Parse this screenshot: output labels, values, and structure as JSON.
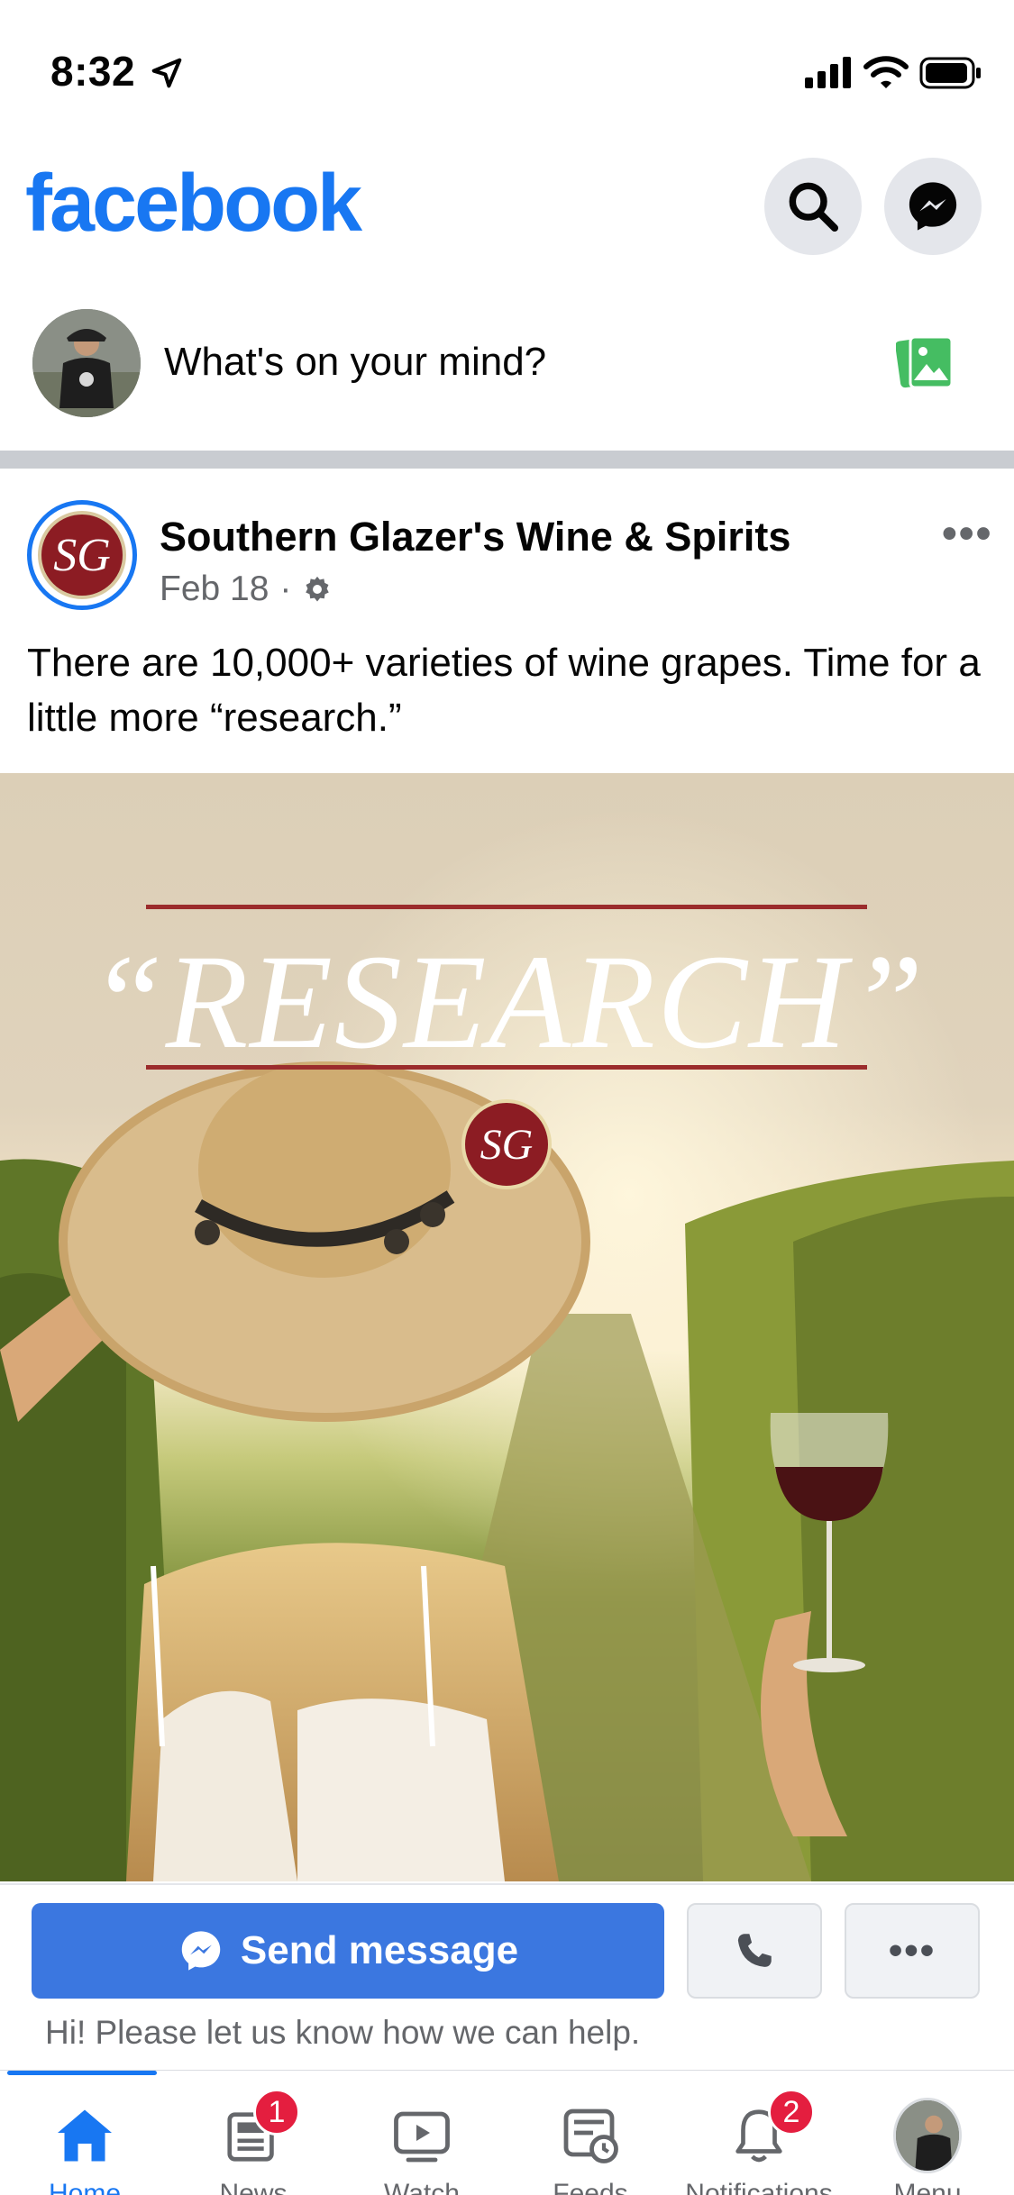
{
  "status_bar": {
    "time": "8:32"
  },
  "header": {
    "logo": "facebook",
    "brand_color": "#1877f2",
    "icons": [
      "search-icon",
      "messenger-icon"
    ]
  },
  "composer": {
    "prompt": "What's on your mind?",
    "photo_icon": "photo-icon"
  },
  "post": {
    "page_name": "Southern Glazer's Wine & Spirits",
    "date": "Feb 18",
    "separator": "·",
    "privacy_icon": "gear-icon",
    "text": "There are 10,000+ varieties of wine grapes. Time for a little more “research.”",
    "image": {
      "headline": "“RESEARCH”",
      "logo_text": "SG"
    },
    "avatar_logo_text": "SG"
  },
  "cta": {
    "send_label": "Send message",
    "accent_color": "#3b77e0",
    "call_icon": "phone-icon",
    "more_label": "•••",
    "helper_text": "Hi! Please let us know how we can help."
  },
  "tab_bar": {
    "tabs": [
      {
        "label": "Home",
        "icon": "home-icon",
        "active": true
      },
      {
        "label": "News",
        "icon": "news-icon",
        "badge": "1"
      },
      {
        "label": "Watch",
        "icon": "watch-icon"
      },
      {
        "label": "Feeds",
        "icon": "feeds-icon"
      },
      {
        "label": "Notifications",
        "icon": "bell-icon",
        "badge": "2"
      },
      {
        "label": "Menu",
        "icon": "menu-avatar"
      }
    ]
  }
}
